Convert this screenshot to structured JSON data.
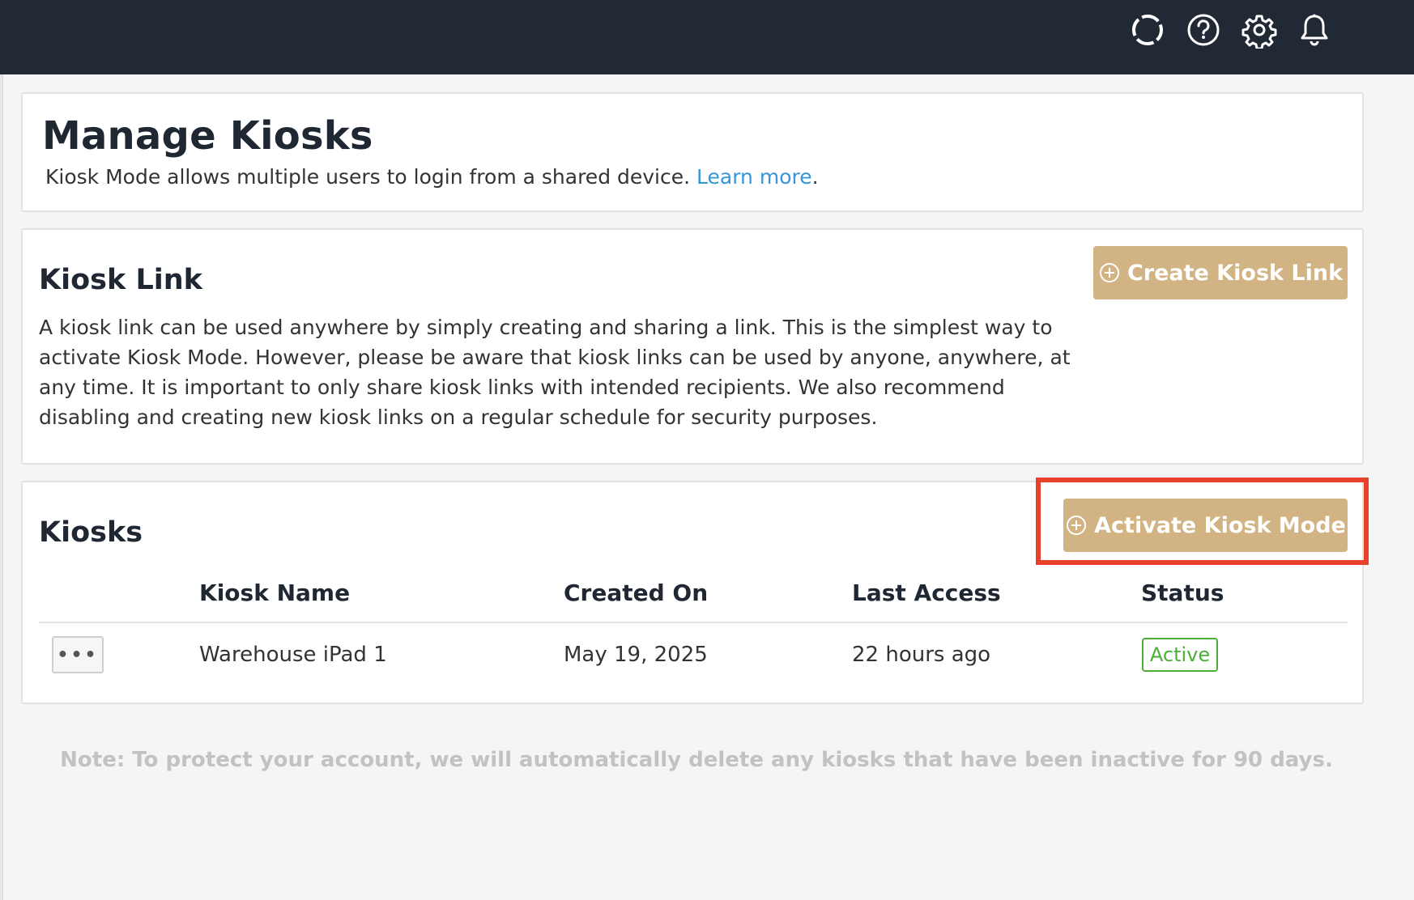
{
  "topbar": {
    "icons": [
      {
        "name": "loading-ring-icon"
      },
      {
        "name": "help-icon"
      },
      {
        "name": "gear-icon"
      },
      {
        "name": "bell-icon"
      }
    ],
    "icon_color": "#ffffff",
    "background": "#212935"
  },
  "header": {
    "title": "Manage Kiosks",
    "subtitle": "Kiosk Mode allows multiple users to login from a shared device.",
    "learn_more": "Learn more",
    "period": "."
  },
  "kiosk_link": {
    "title": "Kiosk Link",
    "description": "A kiosk link can be used anywhere by simply creating and sharing a link. This is the simplest way to activate Kiosk Mode. However, please be aware that kiosk links can be used by anyone, anywhere, at any time. It is important to only share kiosk links with intended recipients. We also recommend disabling and creating new kiosk links on a regular schedule for security purposes.",
    "create_button": "Create Kiosk Link"
  },
  "kiosks": {
    "title": "Kiosks",
    "activate_button": "Activate Kiosk Mode",
    "columns": [
      "Kiosk Name",
      "Created On",
      "Last Access",
      "Status"
    ],
    "rows": [
      {
        "menu": "•••",
        "name": "Warehouse iPad 1",
        "created": "May 19, 2025",
        "last_access": "22 hours ago",
        "status": "Active"
      }
    ]
  },
  "note": "Note: To protect your account, we will automatically delete any kiosks that have been inactive for 90 days.",
  "colors": {
    "accent_gold": "#d2b384",
    "link_blue": "#3596d8",
    "status_green": "#4caf35",
    "highlight_red": "#e8402a"
  }
}
